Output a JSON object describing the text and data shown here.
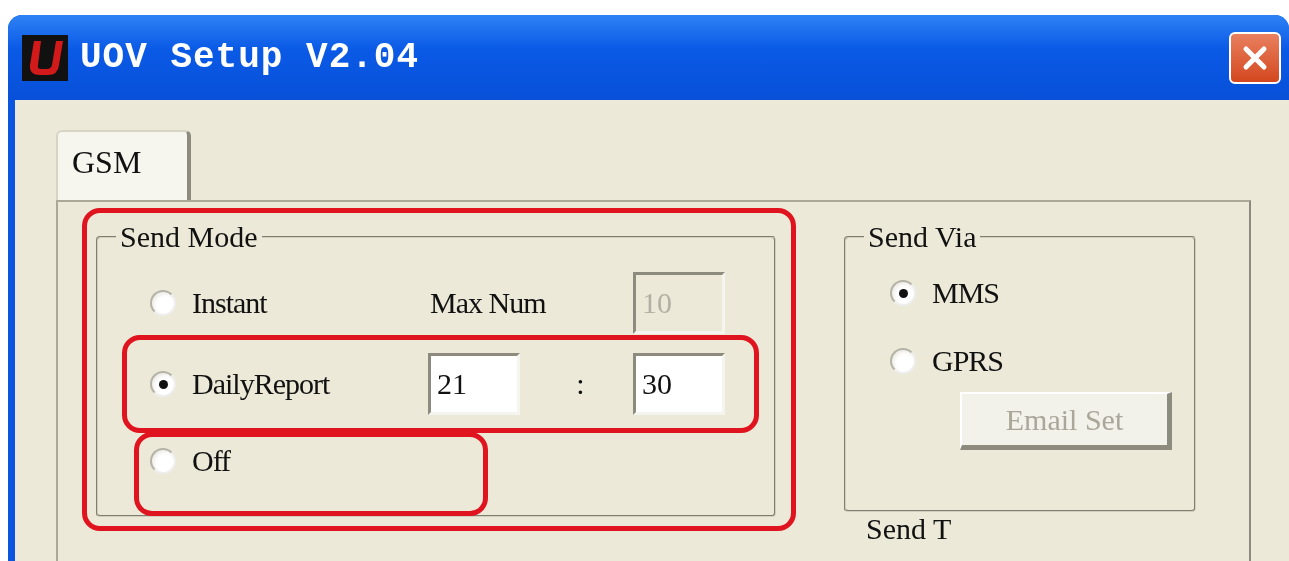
{
  "window": {
    "title": "UOV Setup V2.04"
  },
  "tabs": [
    {
      "label": "GSM",
      "selected": true
    }
  ],
  "send_mode": {
    "legend": "Send Mode",
    "highlighted": true,
    "options": [
      {
        "label": "Instant",
        "selected": false
      },
      {
        "label": "DailyReport",
        "selected": true,
        "highlighted": true
      },
      {
        "label": "Off",
        "selected": false,
        "highlighted": true
      }
    ],
    "max_num": {
      "label": "Max Num",
      "value": "10",
      "disabled": true
    },
    "daily_time": {
      "hour": "21",
      "separator": ":",
      "minute": "30"
    }
  },
  "send_via": {
    "legend": "Send Via",
    "options": [
      {
        "label": "MMS",
        "selected": true
      },
      {
        "label": "GPRS",
        "selected": false
      }
    ],
    "email_button": {
      "label": "Email Set",
      "disabled": true
    }
  },
  "next_group": {
    "legend": "Send T"
  }
}
